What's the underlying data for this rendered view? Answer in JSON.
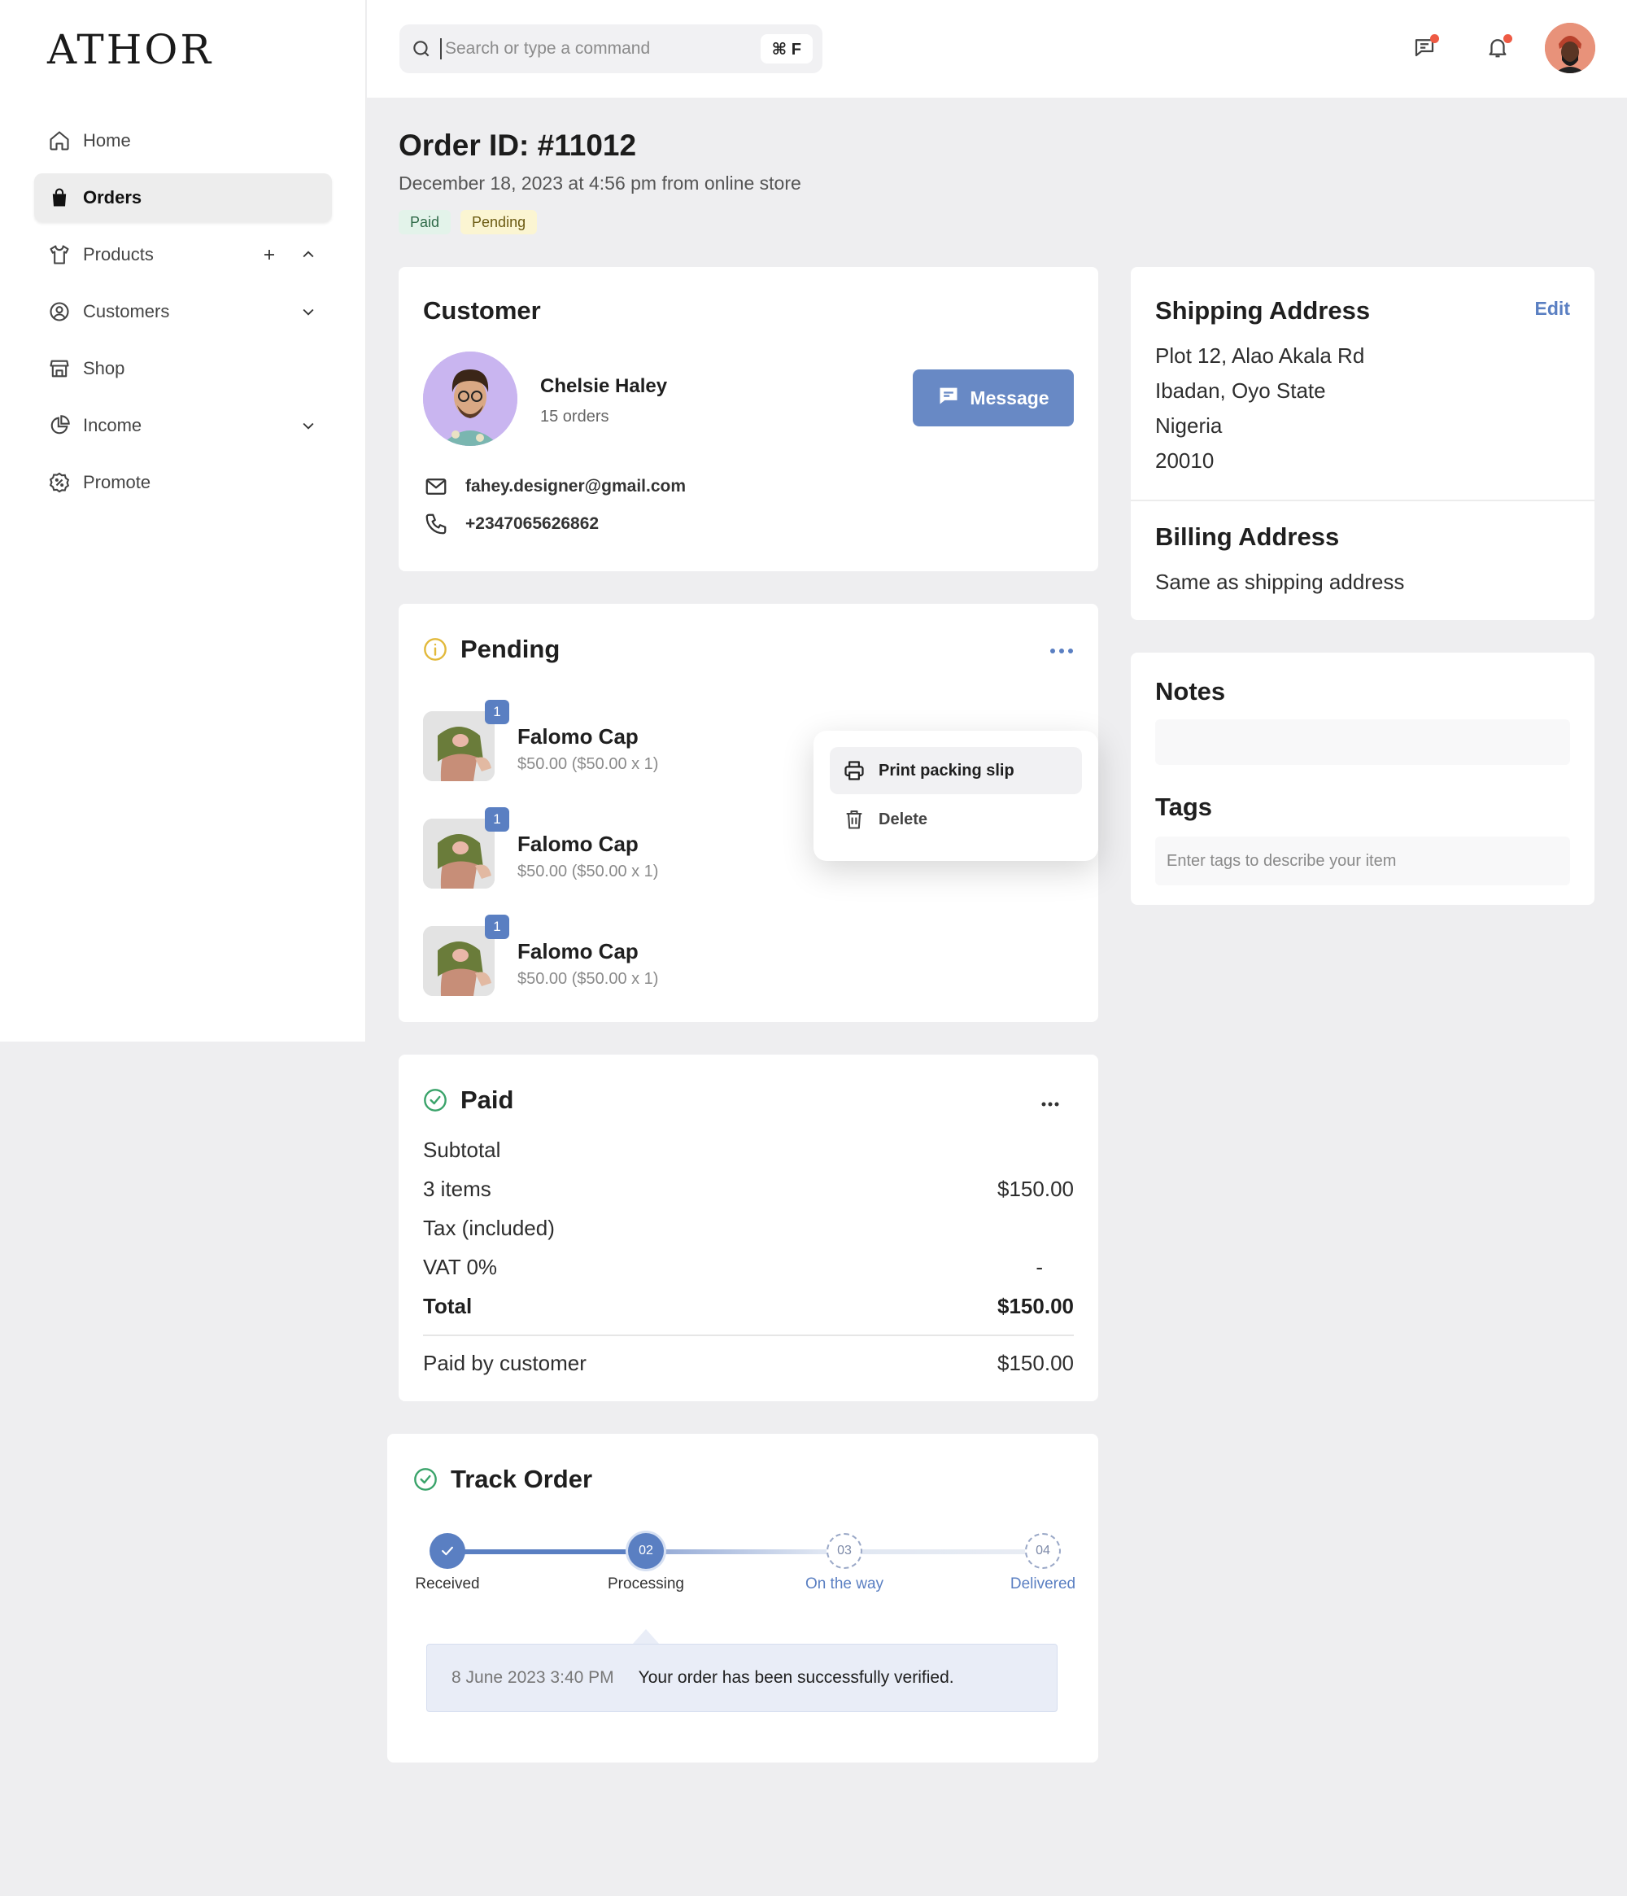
{
  "app": {
    "logo": "ATHOR"
  },
  "sidebar": {
    "items": [
      {
        "label": "Home",
        "icon": "home-icon",
        "active": false
      },
      {
        "label": "Orders",
        "icon": "shopping-bag-icon",
        "active": true
      },
      {
        "label": "Products",
        "icon": "shirt-icon",
        "active": false
      },
      {
        "label": "Customers",
        "icon": "user-circle-icon",
        "active": false
      },
      {
        "label": "Shop",
        "icon": "store-icon",
        "active": false
      },
      {
        "label": "Income",
        "icon": "pie-chart-icon",
        "active": false
      },
      {
        "label": "Promote",
        "icon": "badge-percent-icon",
        "active": false
      }
    ]
  },
  "topbar": {
    "search_placeholder": "Search or type a command",
    "search_shortcut": "⌘ F"
  },
  "order": {
    "title": "Order ID: #11012",
    "subtitle": "December 18, 2023 at 4:56 pm from online store",
    "badges": {
      "paid": "Paid",
      "pending": "Pending"
    }
  },
  "customer": {
    "title": "Customer",
    "name": "Chelsie Haley",
    "orders": "15 orders",
    "message_label": "Message",
    "email": "fahey.designer@gmail.com",
    "phone": "+2347065626862"
  },
  "pending": {
    "title": "Pending",
    "items": [
      {
        "qty": "1",
        "name": "Falomo Cap",
        "price": "$50.00 ($50.00 x 1)"
      },
      {
        "qty": "1",
        "name": "Falomo Cap",
        "price": "$50.00 ($50.00 x 1)"
      },
      {
        "qty": "1",
        "name": "Falomo Cap",
        "price": "$50.00 ($50.00 x 1)"
      }
    ],
    "menu": {
      "print": "Print packing slip",
      "delete": "Delete"
    }
  },
  "paid": {
    "title": "Paid",
    "rows": [
      {
        "label": "Subtotal",
        "value": ""
      },
      {
        "label": "3 items",
        "value": "$150.00"
      },
      {
        "label": "Tax (included)",
        "value": ""
      },
      {
        "label": "VAT 0%",
        "value": "-"
      },
      {
        "label": "Total",
        "value": "$150.00"
      }
    ],
    "paid_by_label": "Paid by customer",
    "paid_by_value": "$150.00"
  },
  "track": {
    "title": "Track Order",
    "steps": [
      {
        "num": "",
        "label": "Received",
        "state": "done"
      },
      {
        "num": "02",
        "label": "Processing",
        "state": "current"
      },
      {
        "num": "03",
        "label": "On the way",
        "state": "todo"
      },
      {
        "num": "04",
        "label": "Delivered",
        "state": "todo"
      }
    ],
    "message_date": "8 June 2023 3:40 PM",
    "message_text": "Your order has been successfully verified."
  },
  "shipping": {
    "title": "Shipping Address",
    "edit_label": "Edit",
    "lines": [
      "Plot 12, Alao Akala Rd",
      "Ibadan, Oyo State",
      "Nigeria",
      "20010"
    ],
    "billing_title": "Billing Address",
    "billing_text": "Same as shipping address"
  },
  "notes": {
    "title": "Notes",
    "tags_title": "Tags",
    "tags_placeholder": "Enter tags to describe your item"
  },
  "colors": {
    "accent": "#5a7fc2",
    "button": "#6889c5",
    "paid_badge": "#e3f3ea",
    "pending_badge": "#fbf5d2",
    "notification_dot": "#ee5a44"
  }
}
